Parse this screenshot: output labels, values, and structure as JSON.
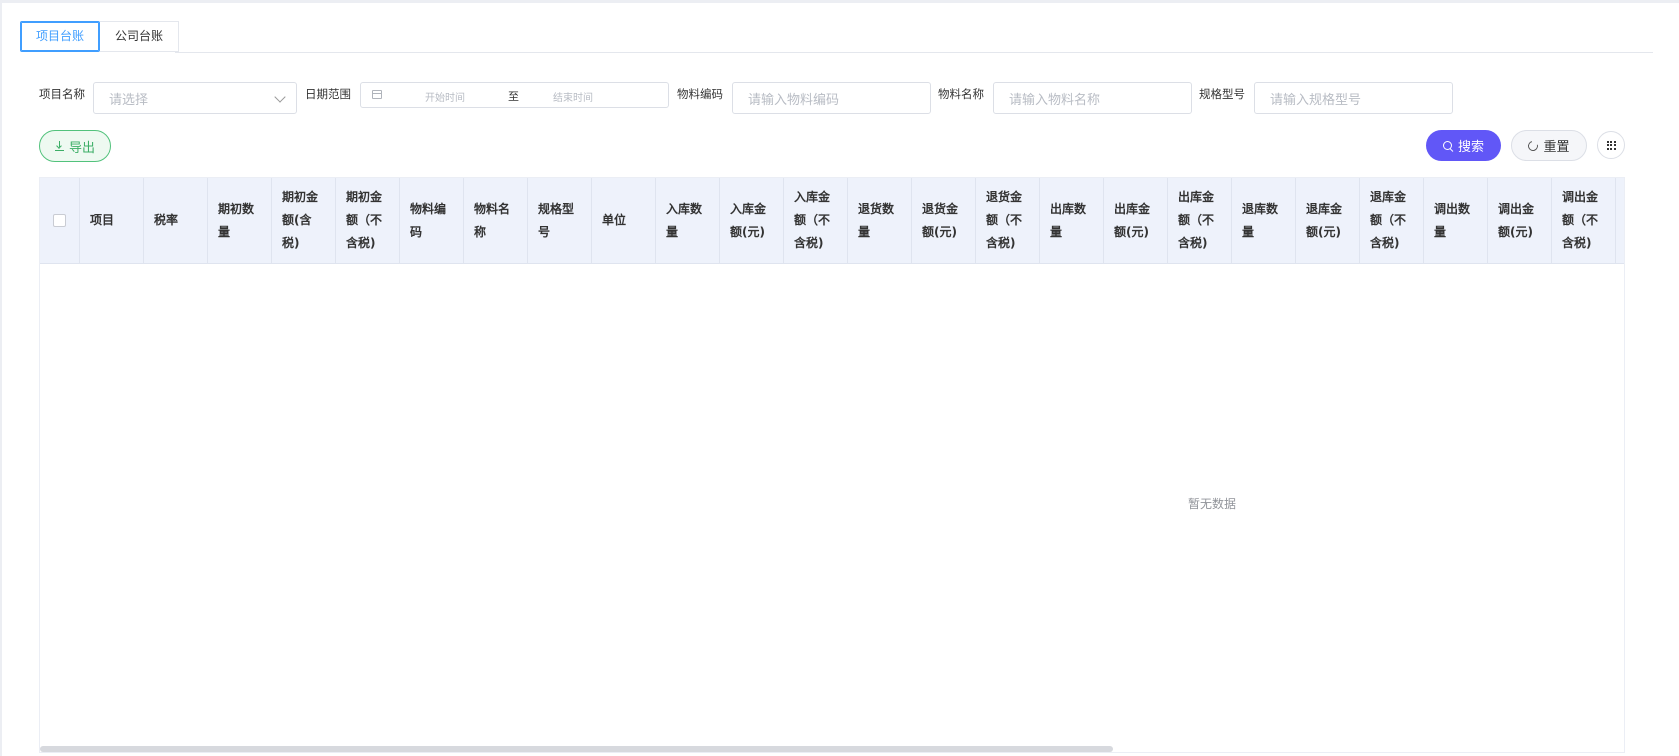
{
  "tabs": [
    {
      "label": "项目台账",
      "active": true
    },
    {
      "label": "公司台账",
      "active": false
    }
  ],
  "filters": {
    "project_name": {
      "label": "项目名称",
      "placeholder": "请选择"
    },
    "date_range": {
      "label": "日期范围",
      "start_placeholder": "开始时间",
      "separator": "至",
      "end_placeholder": "结束时间"
    },
    "material_code": {
      "label": "物料编码",
      "placeholder": "请输入物料编码"
    },
    "material_name": {
      "label": "物料名称",
      "placeholder": "请输入物料名称"
    },
    "spec_model": {
      "label": "规格型号",
      "placeholder": "请输入规格型号"
    }
  },
  "toolbar": {
    "export_label": "导出",
    "search_label": "搜索",
    "reset_label": "重置"
  },
  "table": {
    "columns": [
      "项目",
      "税率",
      "期初数量",
      "期初金额(含税)",
      "期初金额（不含税)",
      "物料编码",
      "物料名称",
      "规格型号",
      "单位",
      "入库数量",
      "入库金额(元)",
      "入库金额（不含税)",
      "退货数量",
      "退货金额(元)",
      "退货金额（不含税)",
      "出库数量",
      "出库金额(元)",
      "出库金额（不含税)",
      "退库数量",
      "退库金额(元)",
      "退库金额（不含税)",
      "调出数量",
      "调出金额(元)",
      "调出金额（不含税)"
    ],
    "empty_text": "暂无数据"
  },
  "colors": {
    "primary": "#409eff",
    "search_button": "#6157f7",
    "export_green": "#3cae66",
    "header_bg": "#eef2fb"
  }
}
